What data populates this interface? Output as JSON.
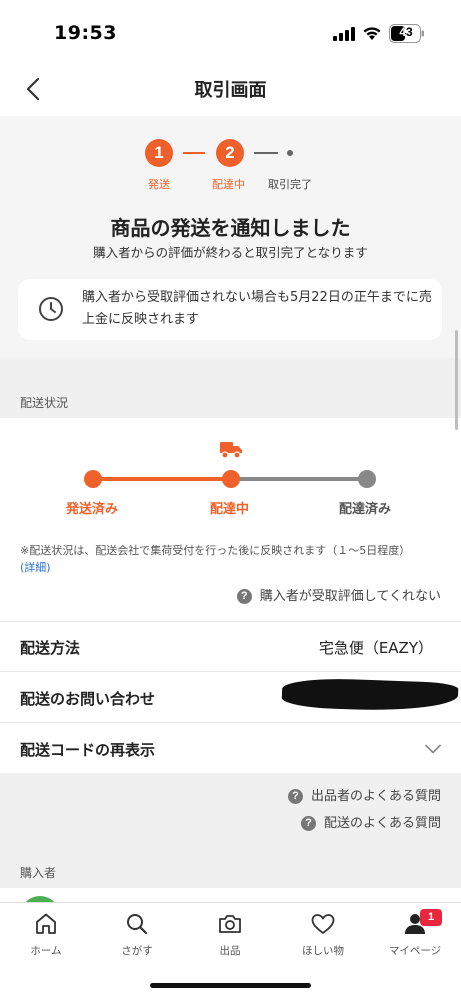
{
  "status_bar": {
    "time": "19:53",
    "battery": "43"
  },
  "nav": {
    "title": "取引画面",
    "back_icon": "chevron-left-icon"
  },
  "progress_steps": [
    {
      "number": "1",
      "label": "発送",
      "state": "done"
    },
    {
      "number": "2",
      "label": "配達中",
      "state": "current"
    },
    {
      "number": "",
      "label": "取引完了",
      "state": "pending"
    }
  ],
  "notice": {
    "headline": "商品の発送を通知しました",
    "subline": "購入者からの評価が終わると取引完了となります",
    "card_text": "購入者から受取評価されない場合も5月22日の正午までに売上金に反映されます",
    "icon": "clock-icon"
  },
  "delivery_status": {
    "section_label": "配送状況",
    "stages": [
      {
        "label": "発送済み",
        "state": "done"
      },
      {
        "label": "配達中",
        "state": "current"
      },
      {
        "label": "配達済み",
        "state": "pending"
      }
    ],
    "note": "※配送状況は、配送会社で集荷受付を行った後に反映されます（１〜5日程度）",
    "detail_link": "(詳細)",
    "help_text": "購入者が受取評価してくれない"
  },
  "rows": {
    "shipping_method_label": "配送方法",
    "shipping_method_value": "宅急便（EAZY）",
    "inquiry_label": "配送のお問い合わせ",
    "code_label": "配送コードの再表示"
  },
  "faq": {
    "seller_faq": "出品者のよくある質問",
    "shipping_faq": "配送のよくある質問",
    "buyer_section_label": "購入者"
  },
  "tabs": [
    {
      "label": "ホーム",
      "icon": "home-icon"
    },
    {
      "label": "さがす",
      "icon": "search-icon"
    },
    {
      "label": "出品",
      "icon": "camera-icon"
    },
    {
      "label": "ほしい物",
      "icon": "heart-icon"
    },
    {
      "label": "マイページ",
      "icon": "user-icon",
      "badge": "1"
    }
  ],
  "colors": {
    "accent": "#f0602a",
    "pending": "#888888",
    "badge": "#e8273d",
    "link": "#2a6fd6"
  }
}
